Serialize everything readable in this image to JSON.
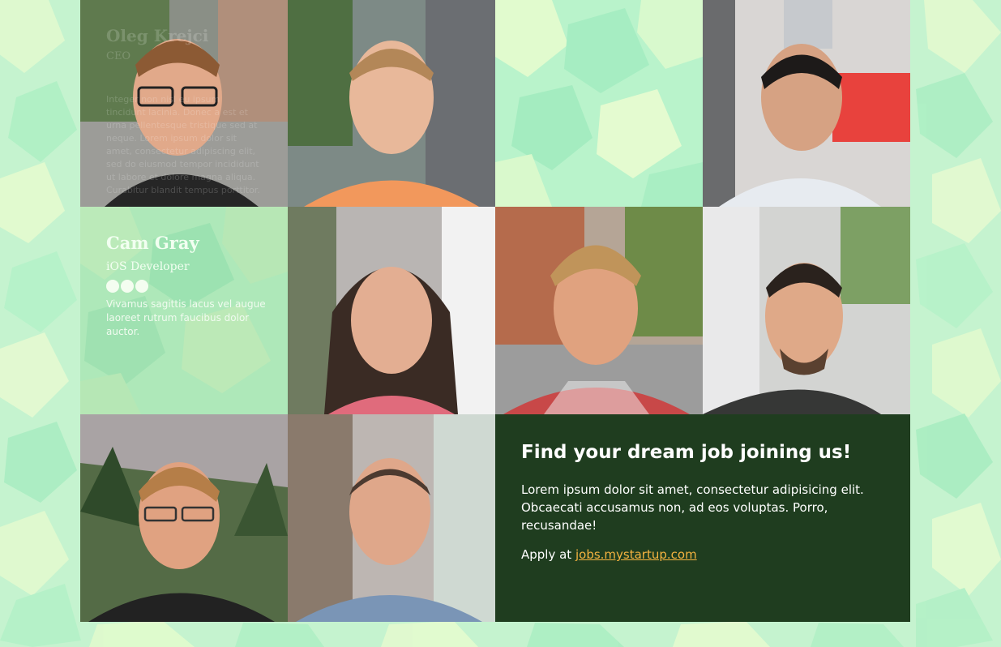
{
  "members": [
    {
      "name": "Oleg Krejci",
      "role": "CEO",
      "bio": "Integer non nisl eu ipsum tincidunt lacinia. Donec a est et urna pellentesque tristique sed at neque. Lorem ipsum dolor sit amet, consectetur adipiscing elit, sed do eiusmod tempor incididunt ut labore et dolore magna aliqua. Curabitur blandit tempus porttitor."
    },
    {
      "name": "Cam Gray",
      "role": "iOS Developer",
      "bio": "Vivamus sagittis lacus vel augue laoreet rutrum faucibus dolor auctor."
    }
  ],
  "join": {
    "title": "Find your dream job joining us!",
    "text": "Lorem ipsum dolor sit amet, consectetur adipisicing elit. Obcaecati accusamus non, ad eos voluptas. Porro, recusandae!",
    "apply_prefix": "Apply at ",
    "apply_link": "jobs.mystartup.com"
  },
  "colors": {
    "accent": "#f4b340",
    "join_bg": "#1f3d1f",
    "pattern_light": "#e6fbcf",
    "pattern_mid": "#b9f2c9",
    "pattern_dark": "#9eebc0"
  }
}
